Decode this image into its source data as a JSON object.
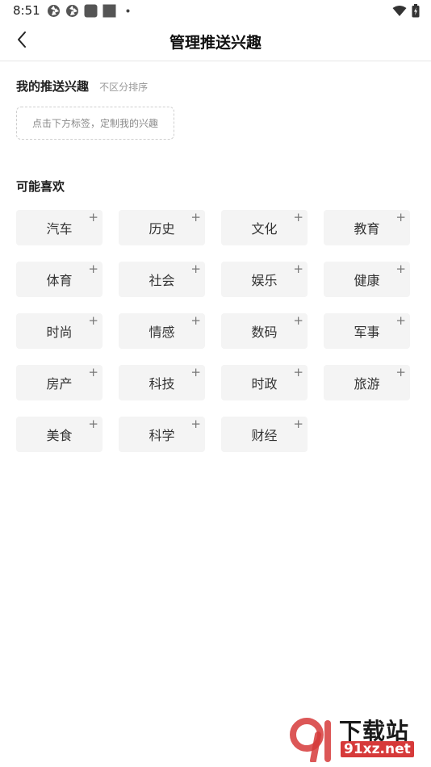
{
  "status_bar": {
    "time": "8:51"
  },
  "header": {
    "title": "管理推送兴趣",
    "back_icon": "chevron-left-icon"
  },
  "my_interests": {
    "title": "我的推送兴趣",
    "hint": "不区分排序",
    "empty_text": "点击下方标签，定制我的兴趣"
  },
  "suggestions": {
    "title": "可能喜欢",
    "tags": [
      "汽车",
      "历史",
      "文化",
      "教育",
      "体育",
      "社会",
      "娱乐",
      "健康",
      "时尚",
      "情感",
      "数码",
      "军事",
      "房产",
      "科技",
      "时政",
      "旅游",
      "美食",
      "科学",
      "财经"
    ],
    "add_symbol": "+"
  },
  "watermark": {
    "text": "下载站",
    "url": "91xz.net",
    "accent_color": "#d63a3a"
  }
}
